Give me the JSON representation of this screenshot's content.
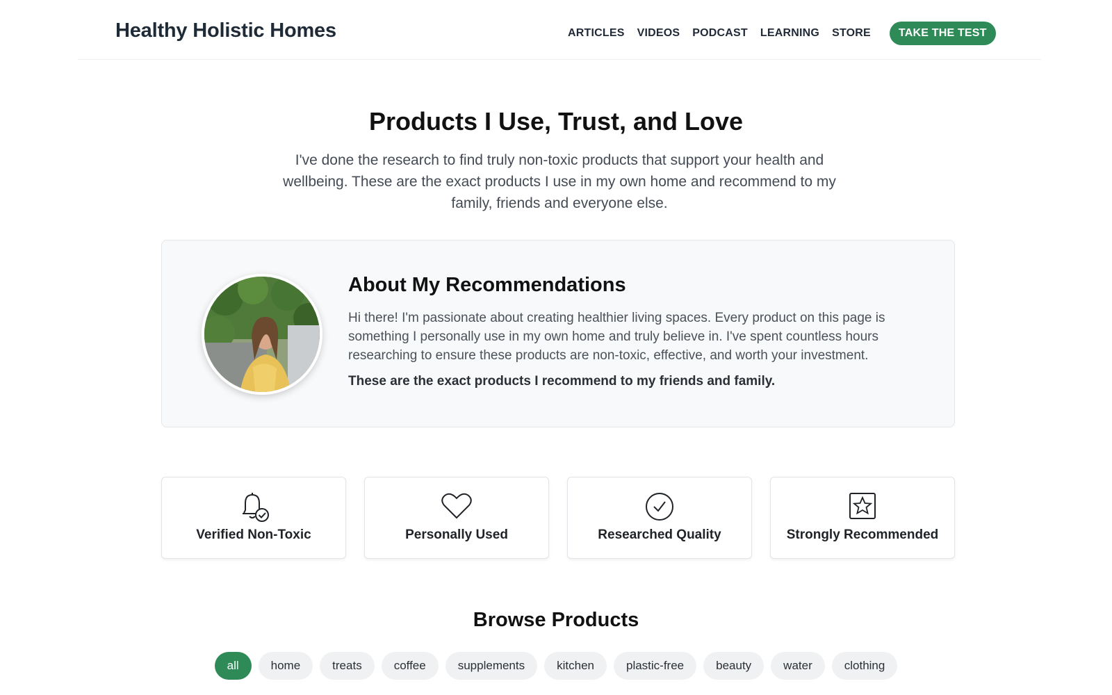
{
  "brand": {
    "name": "Healthy Holistic Homes",
    "accent_color": "#2e8b57"
  },
  "nav": {
    "links": [
      "ARTICLES",
      "VIDEOS",
      "PODCAST",
      "LEARNING",
      "STORE"
    ],
    "cta": "TAKE THE TEST"
  },
  "hero": {
    "title": "Products I Use, Trust, and Love",
    "subtitle": "I've done the research to find truly non-toxic products that support your health and wellbeing. These are the exact products I use in my own home and recommend to my family, friends and everyone else."
  },
  "about": {
    "title": "About My Recommendations",
    "text": "Hi there! I'm passionate about creating healthier living spaces. Every product on this page is something I personally use in my own home and truly believe in. I've spent countless hours researching to ensure these products are non-toxic, effective, and worth your investment.",
    "emphasis": "These are the exact products I recommend to my friends and family.",
    "avatar_icon": "profile-photo"
  },
  "features": [
    {
      "label": "Verified Non-Toxic",
      "icon": "bell-check-icon"
    },
    {
      "label": "Personally Used",
      "icon": "heart-icon"
    },
    {
      "label": "Researched Quality",
      "icon": "check-circle-icon"
    },
    {
      "label": "Strongly Recommended",
      "icon": "star-square-icon"
    }
  ],
  "browse": {
    "title": "Browse Products",
    "filters": [
      "all",
      "home",
      "treats",
      "coffee",
      "supplements",
      "kitchen",
      "plastic-free",
      "beauty",
      "water",
      "clothing"
    ],
    "active_filter": "all"
  }
}
